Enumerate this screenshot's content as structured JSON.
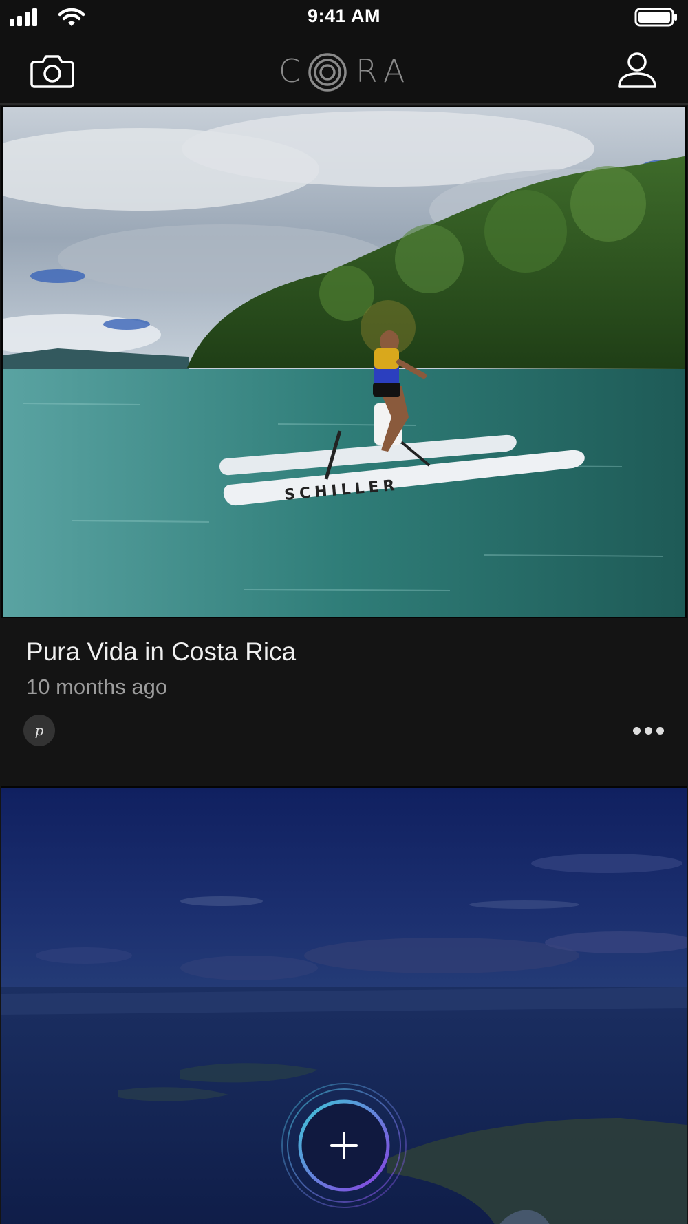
{
  "status_bar": {
    "time": "9:41 AM"
  },
  "nav": {
    "logo_letters": [
      "C",
      "R",
      "A"
    ],
    "camera_icon": "camera-icon",
    "profile_icon": "user-icon"
  },
  "posts": [
    {
      "title": "Pura Vida in Costa Rica",
      "time": "10 months ago",
      "share_icon": "pinterest-icon",
      "share_glyph": "p",
      "more_icon": "more-horizontal-icon",
      "image_text": "SCHILLER"
    },
    {
      "image": "aerial-coastline-photo"
    }
  ],
  "fab": {
    "icon": "plus-icon",
    "glyph": "+"
  },
  "colors": {
    "background": "#141414",
    "header": "#111111",
    "title_text": "#f0f0f0",
    "secondary_text": "#9d9d9d",
    "fab_gradient_start": "#3ec7d6",
    "fab_gradient_end": "#8a3ee0"
  }
}
